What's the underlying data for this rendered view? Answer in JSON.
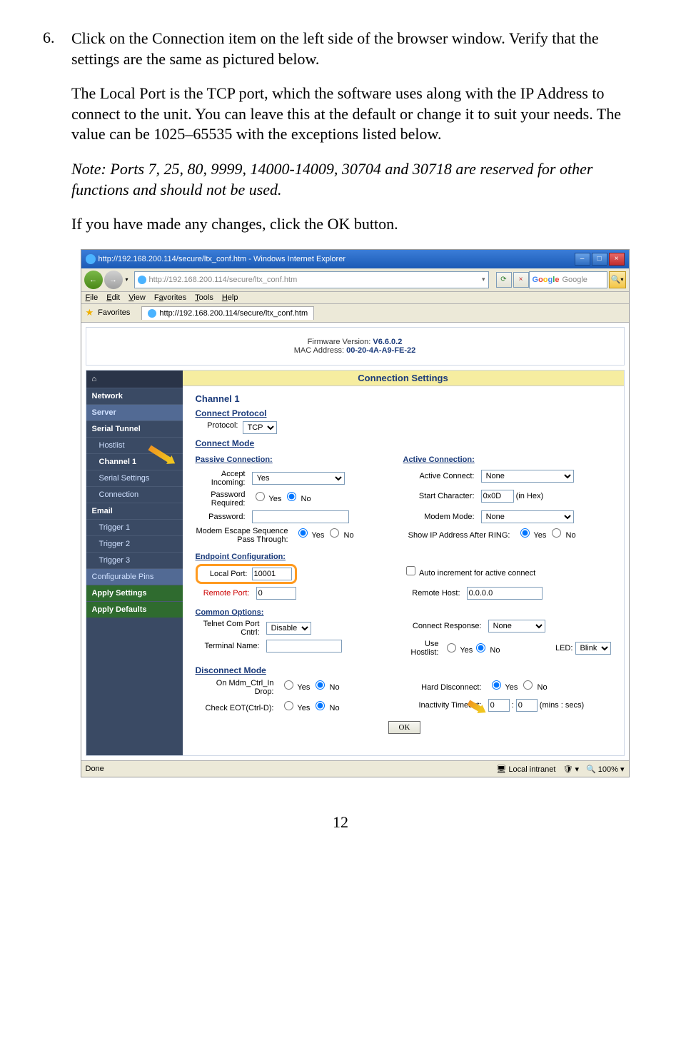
{
  "listNumber": "6.",
  "para1": "Click on the Connection item on the left side of the browser window.  Verify that the settings are the same as pictured below.",
  "para2": "The Local Port is the TCP port, which the software uses along with the IP Address to connect to the unit.  You can leave this at the default or change it to suit your needs.  The value can be 1025–65535 with the exceptions listed below.",
  "para3": "Note: Ports 7, 25, 80, 9999, 14000-14009, 30704 and 30718 are reserved for other functions and should not be used.",
  "para4": "If you have made any changes, click the OK button.",
  "pageNumber": "12",
  "window": {
    "title": "http://192.168.200.114/secure/ltx_conf.htm - Windows Internet Explorer",
    "minimize": "–",
    "maximize": "□",
    "close": "×",
    "url": "http://192.168.200.114/secure/ltx_conf.htm",
    "refreshIcon": "⟳",
    "stopIcon": "×",
    "searchProvider": "Google",
    "searchIcon": "🔍",
    "menus": {
      "file": "File",
      "edit": "Edit",
      "view": "View",
      "favorites": "Favorites",
      "tools": "Tools",
      "help": "Help"
    },
    "favoritesLabel": "Favorites",
    "tabTitle": "http://192.168.200.114/secure/ltx_conf.htm"
  },
  "header": {
    "fwLabel": "Firmware Version:",
    "fwValue": "V6.6.0.2",
    "macLabel": "MAC Address:",
    "macValue": "00-20-4A-A9-FE-22"
  },
  "nav": {
    "home": "⌂",
    "network": "Network",
    "server": "Server",
    "serialTunnel": "Serial Tunnel",
    "hostlist": "Hostlist",
    "channel1": "Channel 1",
    "serialSettings": "Serial Settings",
    "connection": "Connection",
    "email": "Email",
    "trigger1": "Trigger 1",
    "trigger2": "Trigger 2",
    "trigger3": "Trigger 3",
    "configPins": "Configurable Pins",
    "applySettings": "Apply Settings",
    "applyDefaults": "Apply Defaults"
  },
  "settings": {
    "title": "Connection Settings",
    "channel": "Channel 1",
    "connectProtocol": "Connect Protocol",
    "protocolLabel": "Protocol:",
    "protocolValue": "TCP",
    "connectMode": "Connect Mode",
    "passiveConnection": "Passive Connection:",
    "activeConnection": "Active Connection:",
    "acceptIncoming": "Accept Incoming:",
    "acceptIncomingValue": "Yes",
    "activeConnect": "Active Connect:",
    "activeConnectValue": "None",
    "passwordRequired": "Password Required:",
    "startCharacter": "Start Character:",
    "startCharacterValue": "0x0D",
    "inHex": "(in Hex)",
    "password": "Password:",
    "modemMode": "Modem Mode:",
    "modemModeValue": "None",
    "modemEscapeSeq": "Modem Escape Sequence Pass Through:",
    "showIpAfterRing": "Show IP Address After RING:",
    "endpointConfig": "Endpoint Configuration:",
    "localPort": "Local Port:",
    "localPortValue": "10001",
    "autoIncrement": "Auto increment for active connect",
    "remotePort": "Remote Port:",
    "remotePortValue": "0",
    "remoteHost": "Remote Host:",
    "remoteHostValue": "0.0.0.0",
    "commonOptions": "Common Options:",
    "telnetComPort": "Telnet Com Port Cntrl:",
    "telnetValue": "Disable",
    "connectResponse": "Connect Response:",
    "connectResponseValue": "None",
    "terminalName": "Terminal Name:",
    "useHostlist": "Use Hostlist:",
    "led": "LED:",
    "ledValue": "Blink",
    "disconnectMode": "Disconnect Mode",
    "onMdmCtrlIn": "On Mdm_Ctrl_In Drop:",
    "hardDisconnect": "Hard Disconnect:",
    "checkEot": "Check EOT(Ctrl-D):",
    "inactivityTimeout": "Inactivity Timeout:",
    "inactivity1": "0",
    "inactivity2": "0",
    "minsSecs": "(mins : secs)",
    "yes": "Yes",
    "no": "No",
    "ok": "OK"
  },
  "status": {
    "done": "Done",
    "localIntranet": "Local intranet",
    "zoomLevel": "100%"
  }
}
